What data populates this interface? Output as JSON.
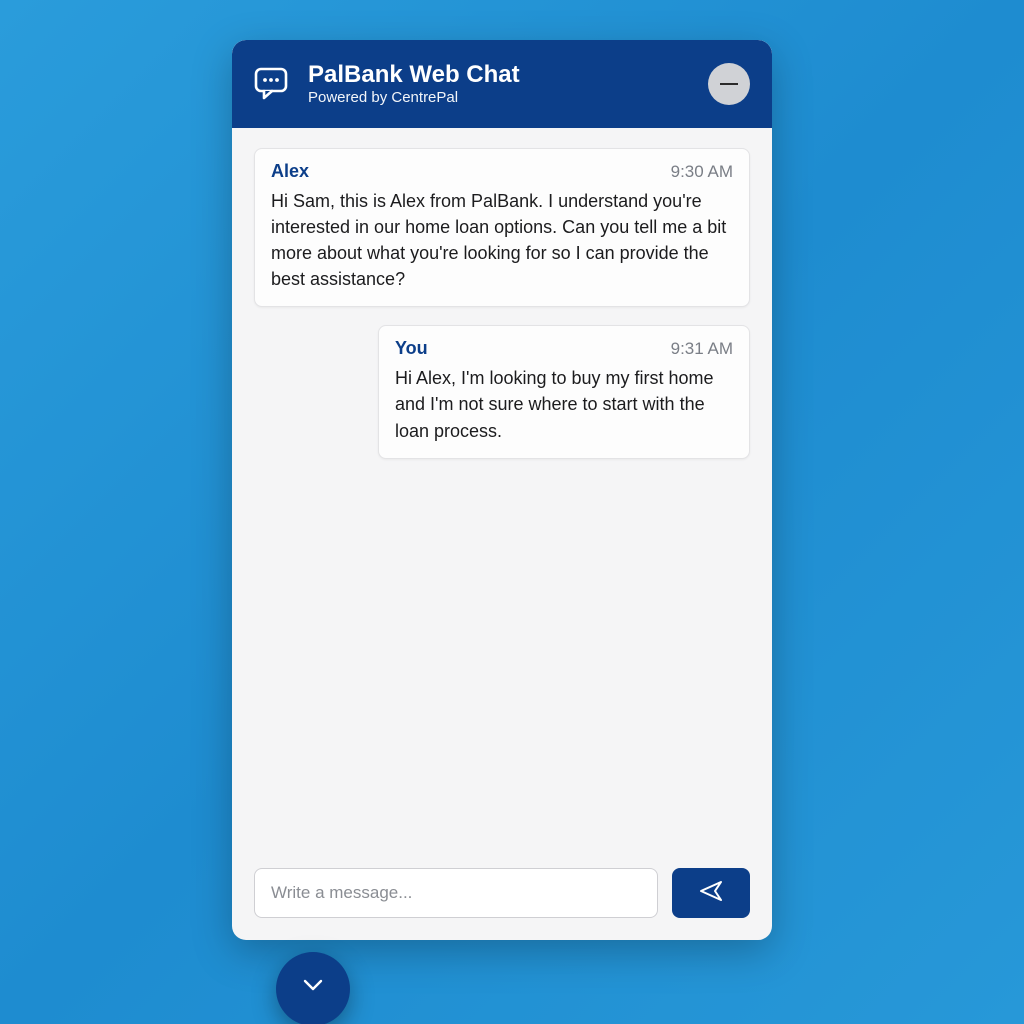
{
  "colors": {
    "brand_primary": "#0c3e89",
    "page_bg_gradient_start": "#2a9cdb",
    "page_bg_gradient_end": "#2798d8",
    "chat_bg": "#f5f5f6",
    "bubble_bg": "#fdfdfd",
    "text": "#1c1c1e",
    "muted": "#7a7e86"
  },
  "header": {
    "title": "PalBank Web Chat",
    "subtitle": "Powered by CentrePal",
    "icon": "chat-bubble-icon",
    "minimize_icon": "minus-icon"
  },
  "messages": [
    {
      "sender": "Alex",
      "role": "agent",
      "timestamp": "9:30 AM",
      "body": "Hi Sam, this is Alex from PalBank. I understand you're interested in our home loan options. Can you tell me a bit more about what you're looking for so I can provide the best assistance?"
    },
    {
      "sender": "You",
      "role": "user",
      "timestamp": "9:31 AM",
      "body": "Hi Alex, I'm looking to buy my first home and I'm not sure where to start with the loan process."
    }
  ],
  "composer": {
    "placeholder": "Write a message...",
    "value": "",
    "send_icon": "send-icon"
  },
  "fab": {
    "icon": "chevron-down-icon"
  }
}
